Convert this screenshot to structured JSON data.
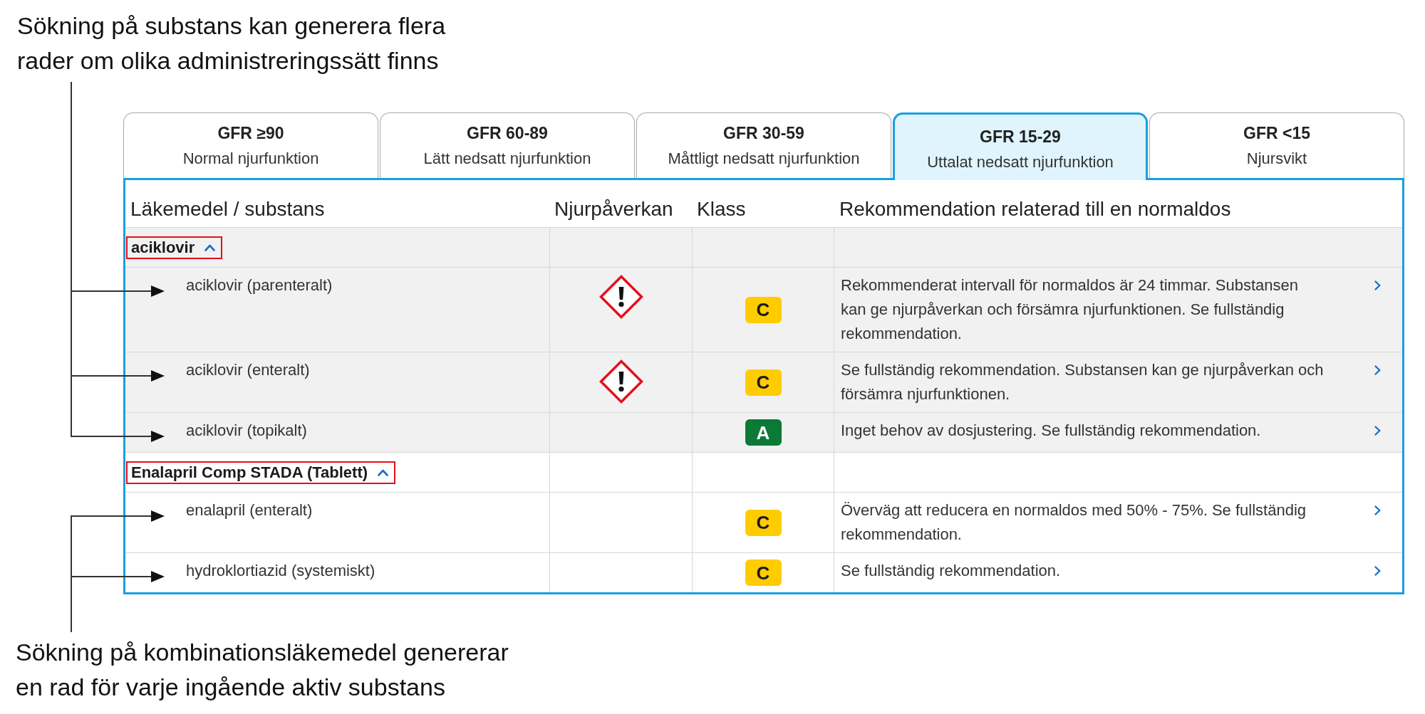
{
  "callout_above": {
    "lines": [
      "Sökning på substans kan generera flera",
      "rader om olika administreringssätt finns"
    ]
  },
  "tabs": [
    {
      "title": "GFR ≥90",
      "subtitle": "Normal njurfunktion",
      "selected": false
    },
    {
      "title": "GFR 60-89",
      "subtitle": "Lätt nedsatt njurfunktion",
      "selected": false
    },
    {
      "title": "GFR 30-59",
      "subtitle": "Måttligt nedsatt njurfunktion",
      "selected": false
    },
    {
      "title": "GFR 15-29",
      "subtitle": "Uttalat nedsatt njurfunktion",
      "selected": true
    },
    {
      "title": "GFR <15",
      "subtitle": "Njursvikt",
      "selected": false
    }
  ],
  "table": {
    "columns": [
      "Läkemedel / substans",
      "Njurpåverkan",
      "Klass",
      "Rekommendation relaterad till en normaldos"
    ],
    "groups": [
      {
        "name": "aciklovir",
        "expanded": true,
        "highlighted": true,
        "shaded": true,
        "items": [
          {
            "name": "aciklovir (parenteralt)",
            "renal_warning": true,
            "class": {
              "label": "C",
              "color": "#ffcc00"
            },
            "recommendation": "Rekommenderat intervall för normaldos är 24 timmar. Substansen kan ge njurpåverkan och försämra njurfunktionen. Se fullständig rekommendation."
          },
          {
            "name": "aciklovir (enteralt)",
            "renal_warning": true,
            "class": {
              "label": "C",
              "color": "#ffcc00"
            },
            "recommendation": "Se fullständig rekommendation. Substansen kan ge njurpåverkan och försämra njurfunktionen."
          },
          {
            "name": "aciklovir (topikalt)",
            "renal_warning": false,
            "class": {
              "label": "A",
              "color": "#0a7a36"
            },
            "recommendation": "Inget behov av dosjustering. Se fullständig rekommendation."
          }
        ]
      },
      {
        "name": "Enalapril Comp STADA (Tablett)",
        "expanded": true,
        "highlighted": true,
        "shaded": false,
        "items": [
          {
            "name": "enalapril (enteralt)",
            "renal_warning": false,
            "class": {
              "label": "C",
              "color": "#ffcc00"
            },
            "recommendation": "Överväg att reducera en normaldos med 50% - 75%. Se fullständig rekommendation."
          },
          {
            "name": "hydroklortiazid (systemiskt)",
            "renal_warning": false,
            "class": {
              "label": "C",
              "color": "#ffcc00"
            },
            "recommendation": "Se fullständig rekommendation."
          }
        ]
      }
    ]
  },
  "callout_below": {
    "lines": [
      "Sökning på kombinationsläkemedel genererar",
      "en rad för varje ingående aktiv substans"
    ]
  }
}
